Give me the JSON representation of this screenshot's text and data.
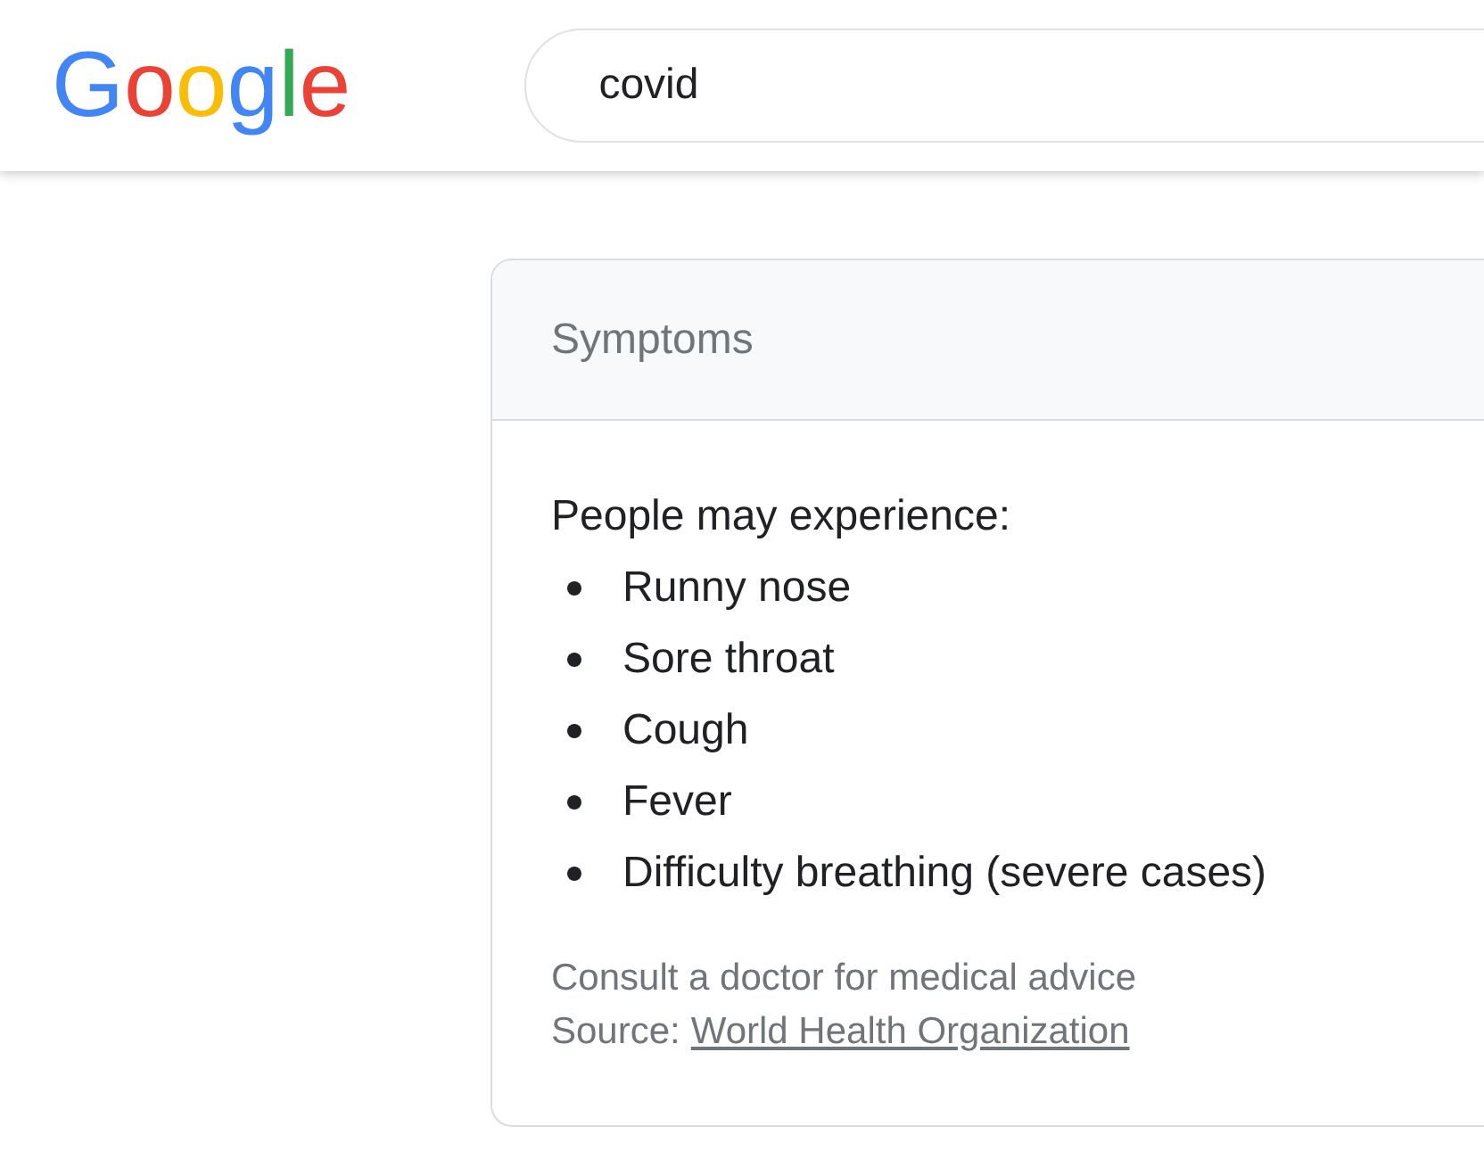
{
  "logo": {
    "text": "Google"
  },
  "search": {
    "value": "covid"
  },
  "card": {
    "title": "Symptoms",
    "intro": "People may experience:",
    "symptoms": [
      "Runny nose",
      "Sore throat",
      "Cough",
      "Fever",
      "Difficulty breathing (severe cases)"
    ],
    "note": "Consult a doctor for medical advice",
    "source_label": "Source:",
    "source_link": "World Health Organization"
  }
}
